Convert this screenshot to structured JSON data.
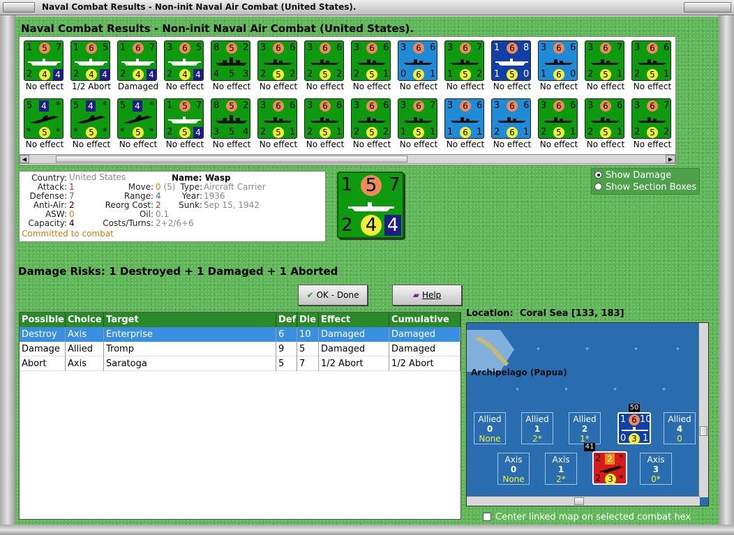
{
  "window": {
    "title": "Naval Combat Results - Non-init Naval Air Combat (United States)."
  },
  "heading": "Naval Combat Results - Non-init Naval Air Combat (United States).",
  "colors": {
    "green": "#0e9a0e",
    "blue": "#1f8bd6",
    "darkblue": "#123ea8",
    "red": "#d81a1a"
  },
  "counters": [
    {
      "color": "green",
      "kind": "carrier",
      "tl": "1",
      "tc": "5",
      "tcs": "orange",
      "tr": "7",
      "bl": "2",
      "bc": "4",
      "bcs": "yellow",
      "br": "4",
      "brs": "sq",
      "label": "No effect"
    },
    {
      "color": "green",
      "kind": "carrier",
      "tl": "1",
      "tc": "6",
      "tcs": "orange",
      "tr": "5",
      "bl": "2",
      "bc": "4",
      "bcs": "yellow",
      "br": "4",
      "brs": "sq",
      "label": "1/2 Abort"
    },
    {
      "color": "green",
      "kind": "carrier",
      "tl": "1",
      "tc": "6",
      "tcs": "orange",
      "tr": "7",
      "bl": "2",
      "bc": "4",
      "bcs": "yellow",
      "br": "4",
      "brs": "sq",
      "label": "Damaged"
    },
    {
      "color": "green",
      "kind": "carrier",
      "tl": "3",
      "tc": "6",
      "tcs": "orange",
      "tr": "5",
      "bl": "2",
      "bc": "4",
      "bcs": "yellow",
      "br": "4",
      "brs": "sq",
      "label": "No effect"
    },
    {
      "color": "green",
      "kind": "battleship",
      "tl": "8",
      "tc": "5",
      "tcs": "orange",
      "tr": "2",
      "bl": "4",
      "bc": "5",
      "bcs": "",
      "br": "3",
      "brs": "",
      "label": "No effect"
    },
    {
      "color": "green",
      "kind": "cruiser",
      "tl": "3",
      "tc": "6",
      "tcs": "orange",
      "tr": "6",
      "bl": "2",
      "bc": "5",
      "bcs": "yellow",
      "br": "2",
      "brs": "",
      "label": "No effect"
    },
    {
      "color": "green",
      "kind": "cruiser",
      "tl": "3",
      "tc": "6",
      "tcs": "orange",
      "tr": "6",
      "bl": "2",
      "bc": "5",
      "bcs": "yellow",
      "br": "2",
      "brs": "",
      "label": "No effect"
    },
    {
      "color": "green",
      "kind": "cruiser",
      "tl": "3",
      "tc": "6",
      "tcs": "orange",
      "tr": "6",
      "bl": "2",
      "bc": "5",
      "bcs": "yellow",
      "br": "1",
      "brs": "",
      "label": "No effect"
    },
    {
      "color": "blue",
      "kind": "cruiser",
      "tl": "3",
      "tc": "6",
      "tcs": "orange",
      "tr": "6",
      "bl": "0",
      "bc": "6",
      "bcs": "yellow",
      "br": "1",
      "brs": "",
      "label": "No effect"
    },
    {
      "color": "green",
      "kind": "cruiser",
      "tl": "3",
      "tc": "6",
      "tcs": "orange",
      "tr": "7",
      "bl": "1",
      "bc": "5",
      "bcs": "yellow",
      "br": "2",
      "brs": "",
      "label": "No effect"
    },
    {
      "color": "darkblue",
      "kind": "carrier",
      "tl": "1",
      "tc": "6",
      "tcs": "orange",
      "tr": "8",
      "bl": "1",
      "bc": "5",
      "bcs": "yellow",
      "br": "0",
      "brs": "",
      "label": "No effect"
    },
    {
      "color": "blue",
      "kind": "cruiser",
      "tl": "3",
      "tc": "6",
      "tcs": "orange",
      "tr": "6",
      "bl": "1",
      "bc": "6",
      "bcs": "yellow",
      "br": "0",
      "brs": "",
      "label": "No effect"
    },
    {
      "color": "green",
      "kind": "cruiser",
      "tl": "3",
      "tc": "6",
      "tcs": "orange",
      "tr": "7",
      "bl": "2",
      "bc": "5",
      "bcs": "yellow",
      "br": "1",
      "brs": "",
      "label": "No effect"
    },
    {
      "color": "green",
      "kind": "cruiser",
      "tl": "3",
      "tc": "6",
      "tcs": "orange",
      "tr": "6",
      "bl": "2",
      "bc": "5",
      "bcs": "yellow",
      "br": "1",
      "brs": "",
      "label": "No effect"
    },
    {
      "color": "green",
      "kind": "plane",
      "tl": "5",
      "tc": "4",
      "tcs": "sq",
      "tr": "*",
      "bl": "*",
      "bc": "5",
      "bcs": "yellow",
      "br": "*",
      "brs": "",
      "label": "No effect"
    },
    {
      "color": "green",
      "kind": "plane",
      "tl": "5",
      "tc": "4",
      "tcs": "sq",
      "tr": "*",
      "bl": "*",
      "bc": "5",
      "bcs": "yellow",
      "br": "*",
      "brs": "",
      "label": "No effect"
    },
    {
      "color": "green",
      "kind": "plane",
      "tl": "5",
      "tc": "4",
      "tcs": "sq",
      "tr": "*",
      "bl": "*",
      "bc": "5",
      "bcs": "yellow",
      "br": "*",
      "brs": "",
      "label": "No effect"
    },
    {
      "color": "green",
      "kind": "carrier",
      "tl": "1",
      "tc": "5",
      "tcs": "orange",
      "tr": "7",
      "bl": "2",
      "bc": "5",
      "bcs": "yellow",
      "br": "4",
      "brs": "sq",
      "label": "No effect"
    },
    {
      "color": "green",
      "kind": "battleship",
      "tl": "8",
      "tc": "5",
      "tcs": "orange",
      "tr": "2",
      "bl": "3",
      "bc": "5",
      "bcs": "",
      "br": "4",
      "brs": "",
      "label": "No effect"
    },
    {
      "color": "green",
      "kind": "cruiser",
      "tl": "3",
      "tc": "6",
      "tcs": "orange",
      "tr": "6",
      "bl": "2",
      "bc": "5",
      "bcs": "yellow",
      "br": "1",
      "brs": "",
      "label": "No effect"
    },
    {
      "color": "green",
      "kind": "cruiser",
      "tl": "3",
      "tc": "6",
      "tcs": "orange",
      "tr": "6",
      "bl": "2",
      "bc": "5",
      "bcs": "yellow",
      "br": "1",
      "brs": "",
      "label": "No effect"
    },
    {
      "color": "green",
      "kind": "cruiser",
      "tl": "3",
      "tc": "6",
      "tcs": "orange",
      "tr": "6",
      "bl": "2",
      "bc": "5",
      "bcs": "yellow",
      "br": "2",
      "brs": "",
      "label": "No effect"
    },
    {
      "color": "green",
      "kind": "cruiser",
      "tl": "3",
      "tc": "6",
      "tcs": "orange",
      "tr": "7",
      "bl": "1",
      "bc": "5",
      "bcs": "yellow",
      "br": "1",
      "brs": "",
      "label": "No effect"
    },
    {
      "color": "blue",
      "kind": "cruiser",
      "tl": "3",
      "tc": "6",
      "tcs": "orange",
      "tr": "6",
      "bl": "1",
      "bc": "6",
      "bcs": "yellow",
      "br": "1",
      "brs": "",
      "label": "No effect"
    },
    {
      "color": "blue",
      "kind": "cruiser",
      "tl": "3",
      "tc": "6",
      "tcs": "orange",
      "tr": "6",
      "bl": "2",
      "bc": "6",
      "bcs": "yellow",
      "br": "1",
      "brs": "",
      "label": "No effect"
    },
    {
      "color": "green",
      "kind": "cruiser",
      "tl": "3",
      "tc": "6",
      "tcs": "orange",
      "tr": "6",
      "bl": "2",
      "bc": "5",
      "bcs": "yellow",
      "br": "1",
      "brs": "",
      "label": "No effect"
    },
    {
      "color": "green",
      "kind": "cruiser",
      "tl": "3",
      "tc": "6",
      "tcs": "orange",
      "tr": "6",
      "bl": "2",
      "bc": "5",
      "bcs": "yellow",
      "br": "1",
      "brs": "",
      "label": "No effect"
    },
    {
      "color": "green",
      "kind": "cruiser",
      "tl": "3",
      "tc": "6",
      "tcs": "orange",
      "tr": "7",
      "bl": "2",
      "bc": "5",
      "bcs": "yellow",
      "br": "2",
      "brs": "",
      "label": "No effect"
    }
  ],
  "unit": {
    "country_label": "Country:",
    "country": "United States",
    "attack_label": "Attack:",
    "attack": "1",
    "defense_label": "Defense:",
    "defense": "7",
    "antiair_label": "Anti-Air:",
    "antiair": "2",
    "asw_label": "ASW:",
    "asw": "0",
    "capacity_label": "Capacity:",
    "capacity": "4",
    "move_label": "Move:",
    "move": "0",
    "move_extra": "(5)",
    "range_label": "Range:",
    "range": "4",
    "reorg_label": "Reorg Cost:",
    "reorg": "2",
    "oil_label": "Oil:",
    "oil": "0.1",
    "costs_label": "Costs/Turns:",
    "costs": "2+2/6+6",
    "name_label": "Name:",
    "name": "Wasp",
    "type_label": "Type:",
    "type": "Aircraft Carrier",
    "year_label": "Year:",
    "year": "1936",
    "sunk_label": "Sunk:",
    "sunk": "Sep 15, 1942",
    "status": "Committed to combat"
  },
  "bigcard": {
    "tl": "1",
    "tc": "5",
    "tr": "7",
    "bl": "2",
    "bc": "4",
    "br": "4"
  },
  "options": {
    "show_damage": "Show Damage",
    "show_sections": "Show Section Boxes"
  },
  "risks": "Damage Risks:  1 Destroyed + 1 Damaged + 1 Aborted",
  "buttons": {
    "ok": "OK - Done",
    "help": "Help"
  },
  "table": {
    "headers": [
      "Possible",
      "Choice",
      "Target",
      "Def",
      "Die",
      "Effect",
      "Cumulative"
    ],
    "rows": [
      [
        "Destroy",
        "Axis",
        "Enterprise",
        "6",
        "10",
        "Damaged",
        "Damaged"
      ],
      [
        "Damage",
        "Allied",
        "Tromp",
        "9",
        "5",
        "Damaged",
        "Damaged"
      ],
      [
        "Abort",
        "Axis",
        "Saratoga",
        "5",
        "7",
        "1/2 Abort",
        "1/2 Abort"
      ]
    ]
  },
  "location": {
    "label": "Location:",
    "value": "Coral Sea [133, 183]"
  },
  "map": {
    "region_label": "Archipelago (Papua)",
    "allied": [
      {
        "t": "Allied",
        "n": "0",
        "v": "None"
      },
      {
        "t": "Allied",
        "n": "1",
        "v": "2*"
      },
      {
        "t": "Allied",
        "n": "2",
        "v": "1*"
      },
      {
        "t": "Allied",
        "n": "4",
        "v": "0"
      }
    ],
    "axis": [
      {
        "t": "Axis",
        "n": "0",
        "v": "None"
      },
      {
        "t": "Axis",
        "n": "1",
        "v": "2*"
      },
      {
        "t": "Axis",
        "n": "3",
        "v": "0*"
      }
    ],
    "unit_blue": {
      "badge": "50",
      "tl": "1",
      "tc": "6",
      "tr": "10",
      "bl": "0",
      "bc": "3",
      "br": "1"
    },
    "unit_red": {
      "badge": "41",
      "tl": "2",
      "tc": "2",
      "tr": "*",
      "bl": "2",
      "bc": "3",
      "br": "*"
    }
  },
  "checkbox": {
    "center": "Center linked map on selected combat hex"
  }
}
